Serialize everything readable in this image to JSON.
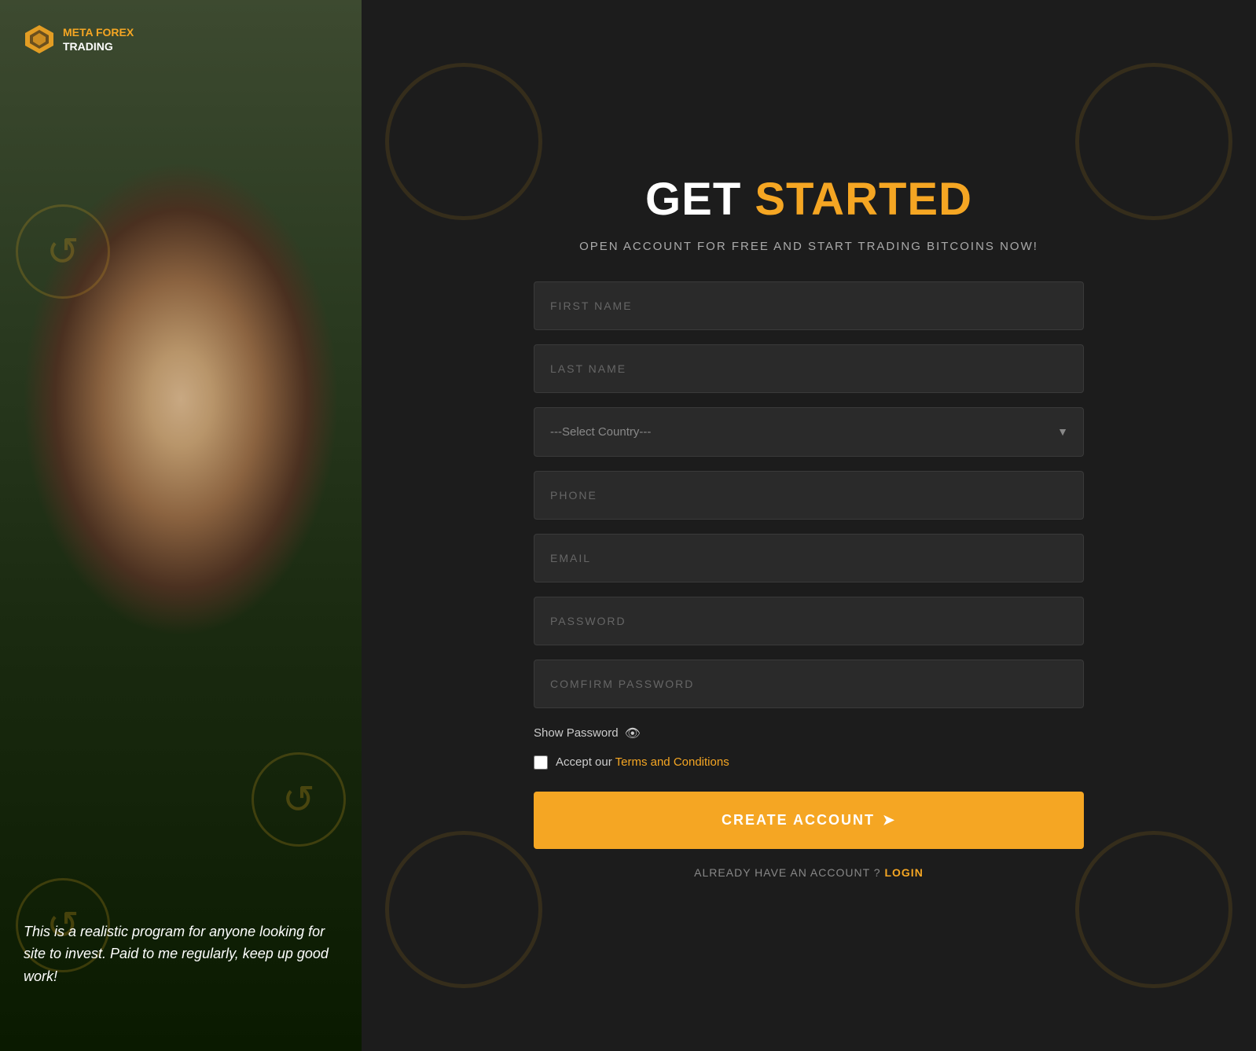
{
  "brand": {
    "name_line1": "META FOREX",
    "name_line2": "TRADING",
    "logo_color": "#f5a623"
  },
  "left_panel": {
    "testimonial": "This is a realistic program for anyone looking for site to invest. Paid to me regularly, keep up good work!"
  },
  "right_panel": {
    "headline_white": "GET",
    "headline_orange": "STARTED",
    "subtitle": "OPEN ACCOUNT FOR FREE AND START TRADING BITCOINS NOW!",
    "fields": {
      "first_name_placeholder": "FIRST NAME",
      "last_name_placeholder": "LAST NAME",
      "country_placeholder": "---Select Country---",
      "phone_placeholder": "PHONE",
      "email_placeholder": "EMAIL",
      "password_placeholder": "PASSWORD",
      "confirm_password_placeholder": "COMFIRM PASSWORD"
    },
    "show_password_label": "Show Password",
    "terms_prefix": "Accept our",
    "terms_link": "Terms and Conditions",
    "create_account_label": "CREATE ACCOUNT",
    "already_account": "ALREADY HAVE AN ACCOUNT ?",
    "login_label": "LOGIN"
  }
}
